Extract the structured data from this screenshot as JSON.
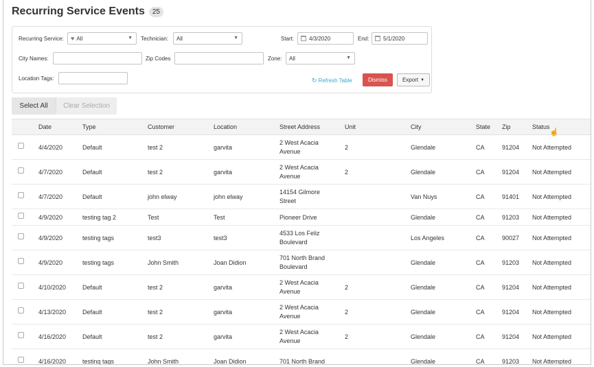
{
  "header": {
    "title": "Recurring Service Events",
    "count": "25"
  },
  "filters": {
    "recurring_service_label": "Recurring Service:",
    "recurring_service_value": "All",
    "technician_label": "Technician:",
    "technician_value": "All",
    "start_label": "Start:",
    "start_value": "4/3/2020",
    "end_label": "End:",
    "end_value": "5/1/2020",
    "city_names_label": "City Names:",
    "city_names_value": "",
    "zip_codes_label": "Zip Codes",
    "zip_codes_value": "",
    "zone_label": "Zone:",
    "zone_value": "All",
    "location_tags_label": "Location Tags:",
    "location_tags_value": ""
  },
  "actions": {
    "refresh": "Refresh Table",
    "dismiss": "Dismiss",
    "export": "Export"
  },
  "selection": {
    "select_all": "Select All",
    "clear_selection": "Clear Selection"
  },
  "table": {
    "columns": [
      "Date",
      "Type",
      "Customer",
      "Location",
      "Street Address",
      "Unit",
      "City",
      "State",
      "Zip",
      "Status"
    ],
    "rows": [
      {
        "date": "4/4/2020",
        "type": "Default",
        "customer": "test 2",
        "location": "garvita",
        "street1": "2 West Acacia",
        "street2": "Avenue",
        "unit": "2",
        "city": "Glendale",
        "state": "CA",
        "zip": "91204",
        "status": "Not Attempted"
      },
      {
        "date": "4/7/2020",
        "type": "Default",
        "customer": "test 2",
        "location": "garvita",
        "street1": "2 West Acacia",
        "street2": "Avenue",
        "unit": "2",
        "city": "Glendale",
        "state": "CA",
        "zip": "91204",
        "status": "Not Attempted"
      },
      {
        "date": "4/7/2020",
        "type": "Default",
        "customer": "john elway",
        "location": "john elway",
        "street1": "14154 Gilmore",
        "street2": "Street",
        "unit": "",
        "city": "Van Nuys",
        "state": "CA",
        "zip": "91401",
        "status": "Not Attempted"
      },
      {
        "date": "4/9/2020",
        "type": "testing tag 2",
        "customer": "Test",
        "location": "Test",
        "street1": "Pioneer Drive",
        "street2": "",
        "unit": "",
        "city": "Glendale",
        "state": "CA",
        "zip": "91203",
        "status": "Not Attempted"
      },
      {
        "date": "4/9/2020",
        "type": "testing tags",
        "customer": "test3",
        "location": "test3",
        "street1": "4533 Los Feliz",
        "street2": "Boulevard",
        "unit": "",
        "city": "Los Angeles",
        "state": "CA",
        "zip": "90027",
        "status": "Not Attempted"
      },
      {
        "date": "4/9/2020",
        "type": "testing tags",
        "customer": "John Smith",
        "location": "Joan Didion",
        "street1": "701 North Brand",
        "street2": "Boulevard",
        "unit": "",
        "city": "Glendale",
        "state": "CA",
        "zip": "91203",
        "status": "Not Attempted"
      },
      {
        "date": "4/10/2020",
        "type": "Default",
        "customer": "test 2",
        "location": "garvita",
        "street1": "2 West Acacia",
        "street2": "Avenue",
        "unit": "2",
        "city": "Glendale",
        "state": "CA",
        "zip": "91204",
        "status": "Not Attempted"
      },
      {
        "date": "4/13/2020",
        "type": "Default",
        "customer": "test 2",
        "location": "garvita",
        "street1": "2 West Acacia",
        "street2": "Avenue",
        "unit": "2",
        "city": "Glendale",
        "state": "CA",
        "zip": "91204",
        "status": "Not Attempted"
      },
      {
        "date": "4/16/2020",
        "type": "Default",
        "customer": "test 2",
        "location": "garvita",
        "street1": "2 West Acacia",
        "street2": "Avenue",
        "unit": "2",
        "city": "Glendale",
        "state": "CA",
        "zip": "91204",
        "status": "Not Attempted"
      },
      {
        "date": "4/16/2020",
        "type": "testing tags",
        "customer": "John Smith",
        "location": "Joan Didion",
        "street1": "701 North Brand",
        "street2": "",
        "unit": "",
        "city": "Glendale",
        "state": "CA",
        "zip": "91203",
        "status": "Not Attempted"
      }
    ]
  }
}
